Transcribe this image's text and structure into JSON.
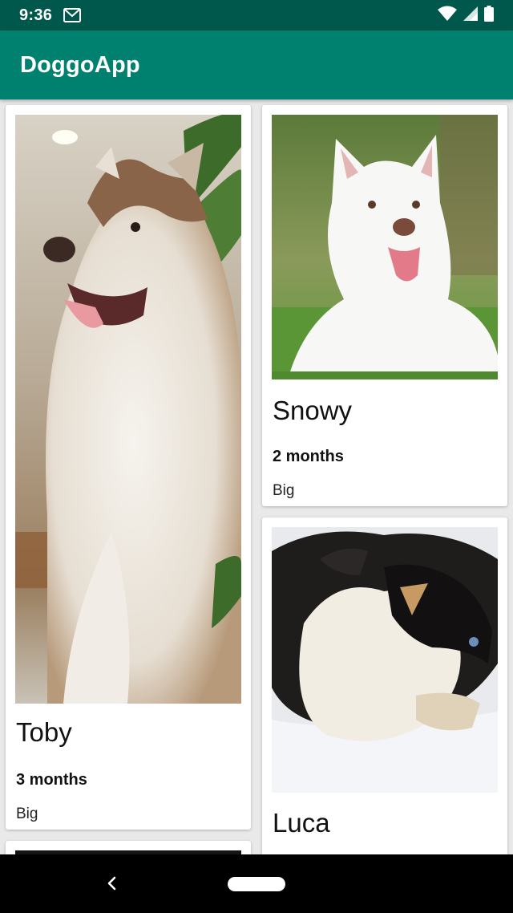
{
  "status_bar": {
    "time": "9:36",
    "icons": [
      "gmail-icon",
      "wifi-icon",
      "cell-signal-icon",
      "battery-icon"
    ]
  },
  "app_bar": {
    "title": "DoggoApp"
  },
  "dogs": [
    {
      "name": "Toby",
      "age": "3 months",
      "size": "Big"
    },
    {
      "name": "Snowy",
      "age": "2 months",
      "size": "Big"
    },
    {
      "name": "Luca"
    }
  ],
  "nav_bar": {
    "icons": [
      "back-icon",
      "home-pill-icon"
    ]
  },
  "colors": {
    "status_bar": "#00574b",
    "app_bar": "#00806e",
    "background": "#e9e9e9"
  }
}
